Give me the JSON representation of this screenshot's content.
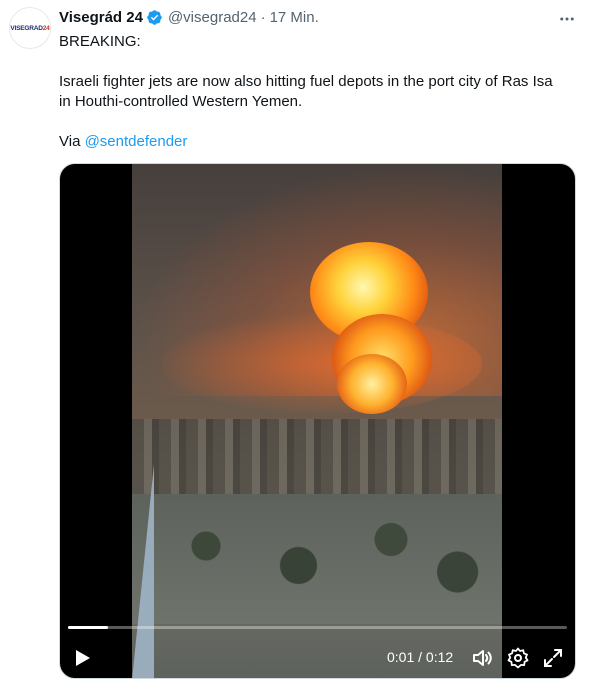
{
  "tweet": {
    "author_name": "Visegrád 24",
    "handle": "@visegrad24",
    "separator": "·",
    "time": "17 Min.",
    "avatar_logo": "VISEGRAD24",
    "lines": [
      "BREAKING:",
      "Israeli fighter jets are now also hitting fuel depots in the port city of Ras Isa",
      "in Houthi-controlled Western Yemen."
    ],
    "via_prefix": "Via ",
    "via_link": "@sentdefender"
  },
  "video": {
    "current_time": "0:01",
    "duration_sep": " / ",
    "duration": "0:12",
    "progress": 0.08
  },
  "colors": {
    "link": "#1d9bf0",
    "verified": "#1d9bf0",
    "muted": "#536471"
  },
  "icons": [
    "verified-badge-icon",
    "more-options-icon",
    "play-icon",
    "volume-icon",
    "settings-icon",
    "fullscreen-icon"
  ]
}
